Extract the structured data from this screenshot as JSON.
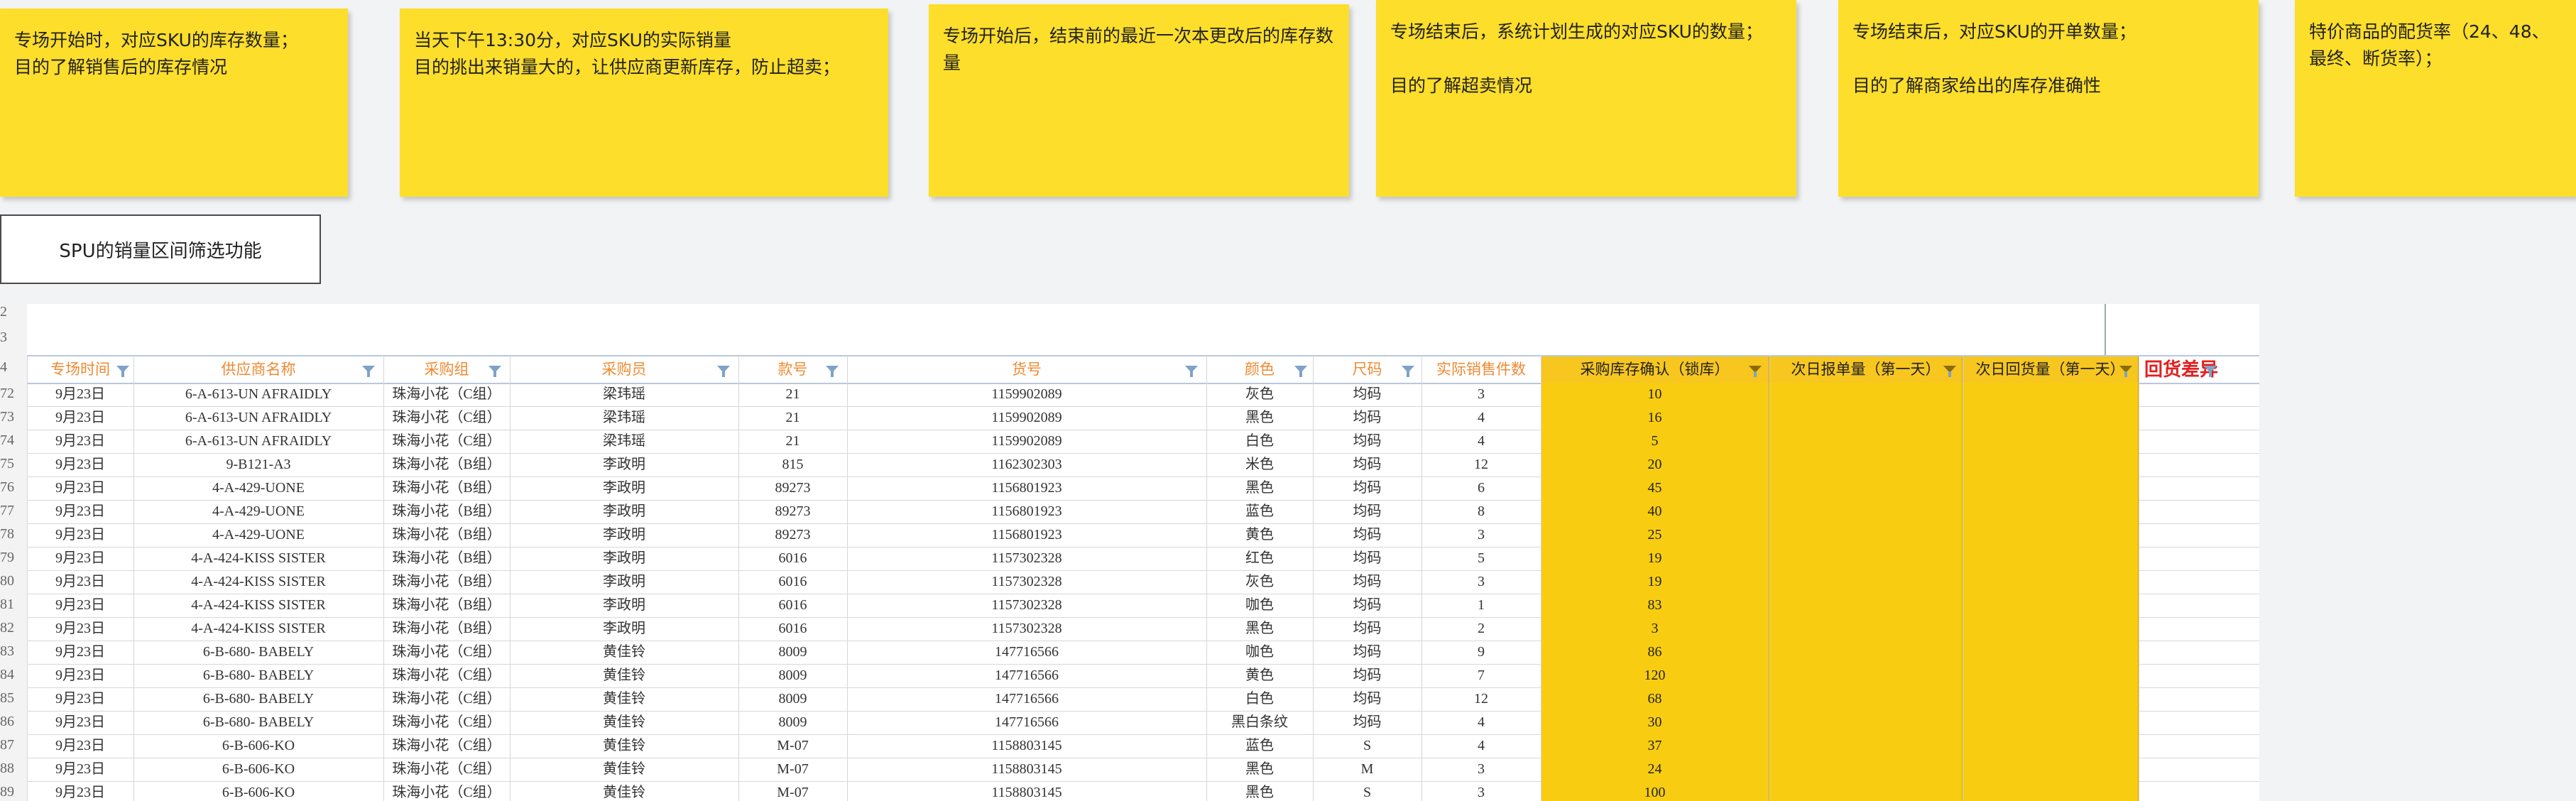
{
  "notes": [
    {
      "text": "专场开始时，对应SKU的库存数量；\n目的了解销售后的库存情况"
    },
    {
      "text": "当天下午13:30分，对应SKU的实际销量\n目的挑出来销量大的，让供应商更新库存，防止超卖；"
    },
    {
      "text": "专场开始后，结束前的最近一次本更改后的库存数量"
    },
    {
      "text": "专场结束后，系统计划生成的对应SKU的数量；\n\n目的了解超卖情况"
    },
    {
      "text": "专场结束后，对应SKU的开单数量；\n\n目的了解商家给出的库存准确性"
    },
    {
      "text": "特价商品的配货率（24、48、最终、断货率）；"
    }
  ],
  "filter_button": {
    "label": "SPU的销量区间筛选功能"
  },
  "sheet": {
    "top_row_numbers": [
      "2",
      "3"
    ],
    "header_row_number": "4",
    "columns": [
      {
        "label": "专场时间"
      },
      {
        "label": "供应商名称"
      },
      {
        "label": "采购组"
      },
      {
        "label": "采购员"
      },
      {
        "label": "款号"
      },
      {
        "label": "货号"
      },
      {
        "label": "颜色"
      },
      {
        "label": "尺码"
      },
      {
        "label": "实际销售件数"
      },
      {
        "label": "采购库存确认（锁库）"
      },
      {
        "label": "次日报单量（第一天）"
      },
      {
        "label": "次日回货量（第一天）"
      },
      {
        "label": "回货差异"
      }
    ],
    "rows": [
      {
        "n": "72",
        "c": [
          "9月23日",
          "6-A-613-UN AFRAIDLY",
          "珠海小花（C组）",
          "梁玮瑶",
          "21",
          "1159902089",
          "灰色",
          "均码",
          "3",
          "10"
        ]
      },
      {
        "n": "73",
        "c": [
          "9月23日",
          "6-A-613-UN AFRAIDLY",
          "珠海小花（C组）",
          "梁玮瑶",
          "21",
          "1159902089",
          "黑色",
          "均码",
          "4",
          "16"
        ]
      },
      {
        "n": "74",
        "c": [
          "9月23日",
          "6-A-613-UN AFRAIDLY",
          "珠海小花（C组）",
          "梁玮瑶",
          "21",
          "1159902089",
          "白色",
          "均码",
          "4",
          "5"
        ]
      },
      {
        "n": "75",
        "c": [
          "9月23日",
          "9-B121-A3",
          "珠海小花（B组）",
          "李政明",
          "815",
          "1162302303",
          "米色",
          "均码",
          "12",
          "20"
        ]
      },
      {
        "n": "76",
        "c": [
          "9月23日",
          "4-A-429-UONE",
          "珠海小花（B组）",
          "李政明",
          "89273",
          "1156801923",
          "黑色",
          "均码",
          "6",
          "45"
        ]
      },
      {
        "n": "77",
        "c": [
          "9月23日",
          "4-A-429-UONE",
          "珠海小花（B组）",
          "李政明",
          "89273",
          "1156801923",
          "蓝色",
          "均码",
          "8",
          "40"
        ]
      },
      {
        "n": "78",
        "c": [
          "9月23日",
          "4-A-429-UONE",
          "珠海小花（B组）",
          "李政明",
          "89273",
          "1156801923",
          "黄色",
          "均码",
          "3",
          "25"
        ]
      },
      {
        "n": "79",
        "c": [
          "9月23日",
          "4-A-424-KISS SISTER",
          "珠海小花（B组）",
          "李政明",
          "6016",
          "1157302328",
          "红色",
          "均码",
          "5",
          "19"
        ]
      },
      {
        "n": "80",
        "c": [
          "9月23日",
          "4-A-424-KISS SISTER",
          "珠海小花（B组）",
          "李政明",
          "6016",
          "1157302328",
          "灰色",
          "均码",
          "3",
          "19"
        ]
      },
      {
        "n": "81",
        "c": [
          "9月23日",
          "4-A-424-KISS SISTER",
          "珠海小花（B组）",
          "李政明",
          "6016",
          "1157302328",
          "咖色",
          "均码",
          "1",
          "83"
        ]
      },
      {
        "n": "82",
        "c": [
          "9月23日",
          "4-A-424-KISS SISTER",
          "珠海小花（B组）",
          "李政明",
          "6016",
          "1157302328",
          "黑色",
          "均码",
          "2",
          "3"
        ]
      },
      {
        "n": "83",
        "c": [
          "9月23日",
          "6-B-680- BABELY",
          "珠海小花（C组）",
          "黄佳铃",
          "8009",
          "147716566",
          "咖色",
          "均码",
          "9",
          "86"
        ]
      },
      {
        "n": "84",
        "c": [
          "9月23日",
          "6-B-680- BABELY",
          "珠海小花（C组）",
          "黄佳铃",
          "8009",
          "147716566",
          "黄色",
          "均码",
          "7",
          "120"
        ]
      },
      {
        "n": "85",
        "c": [
          "9月23日",
          "6-B-680- BABELY",
          "珠海小花（C组）",
          "黄佳铃",
          "8009",
          "147716566",
          "白色",
          "均码",
          "12",
          "68"
        ]
      },
      {
        "n": "86",
        "c": [
          "9月23日",
          "6-B-680- BABELY",
          "珠海小花（C组）",
          "黄佳铃",
          "8009",
          "147716566",
          "黑白条纹",
          "均码",
          "4",
          "30"
        ]
      },
      {
        "n": "87",
        "c": [
          "9月23日",
          "6-B-606-KO",
          "珠海小花（C组）",
          "黄佳铃",
          "M-07",
          "1158803145",
          "蓝色",
          "S",
          "4",
          "37"
        ]
      },
      {
        "n": "88",
        "c": [
          "9月23日",
          "6-B-606-KO",
          "珠海小花（C组）",
          "黄佳铃",
          "M-07",
          "1158803145",
          "黑色",
          "M",
          "3",
          "24"
        ]
      },
      {
        "n": "89",
        "c": [
          "9月23日",
          "6-B-606-KO",
          "珠海小花（C组）",
          "黄佳铃",
          "M-07",
          "1158803145",
          "黑色",
          "S",
          "3",
          "100"
        ]
      }
    ]
  },
  "colors": {
    "note_yellow": "#fdde2a",
    "header_text": "#f08a32",
    "highlight_yellow": "#f8cd11",
    "diff_red": "#e02020"
  }
}
